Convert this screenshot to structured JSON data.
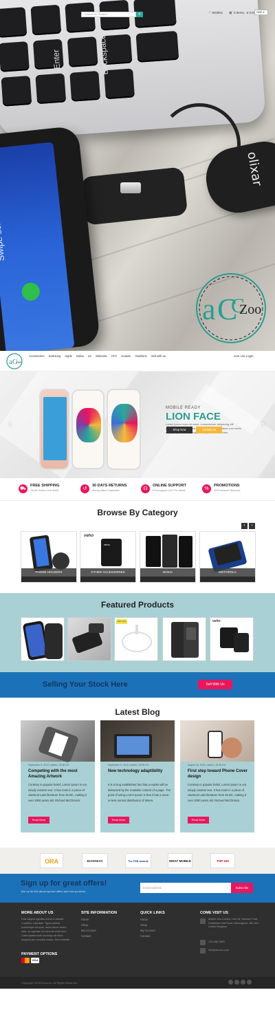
{
  "hero": {
    "phone_text": "Swipe screen to unlock",
    "brand_device": "olixar",
    "key_backspace": "Backspace",
    "key_enter": "Enter"
  },
  "logo": {
    "text": "aCCZoo"
  },
  "header": {
    "nav": [
      "Accessories",
      "Samsung",
      "Apple",
      "Nokia",
      "LG",
      "Motorola",
      "HTC",
      "Huawei",
      "Vodafone",
      "Sell with us"
    ],
    "account": "Join Us/ Login",
    "search_placeholder": "Search for Product",
    "wishlist": "Wishlist",
    "cart": "0 Items - £ 0.00",
    "currency": "GBP £"
  },
  "slider": {
    "subheading": "MOBILE READY",
    "heading": "LION FACE",
    "description": "Lorem ipsum dolor sit amet, consectetuer adipiscing elit. Aenean commodo ligula eget dolor. Aenean massa cum sociis natoque penatibus et magnis dis parturient montes.",
    "btn_shop": "Shop Now",
    "btn_contact": "Contact us",
    "prev": "‹",
    "next": "›"
  },
  "features": [
    {
      "icon": "truck-icon",
      "title": "FREE SHIPPING",
      "sub": "On All Orders Over $120"
    },
    {
      "icon": "return-icon",
      "title": "30 DAYS RETURNS",
      "sub": "Money Back Guarantee"
    },
    {
      "icon": "headset-icon",
      "title": "ONLINE SUPPORT",
      "sub": "Free support 24/7 Per Week"
    },
    {
      "icon": "tag-icon",
      "title": "PROMOTIONS",
      "sub": "10% Member Discount"
    }
  ],
  "categories": {
    "title": "Browse By Category",
    "items": [
      {
        "label": "PHONE HOLDERS",
        "bar": "PHONE HOLDERS"
      },
      {
        "label": "OTHER ACCESSORIES",
        "bar": "OTHER ACCESSORIES"
      },
      {
        "label": "NOKIA",
        "bar": "NOKIA"
      },
      {
        "label": "MOTOROLA",
        "bar": "MOTOROLA"
      }
    ]
  },
  "featured": {
    "title": "Featured Products",
    "sale_badge": "20% OFF"
  },
  "selling": {
    "text": "Selling Your Stock Here",
    "button": "Sell With Us"
  },
  "blog": {
    "title": "Latest Blog",
    "posts": [
      {
        "meta": "September 9, 2015  |  admin  |  36 BLOG",
        "title": "Competing with the most Amazing Artwork",
        "text": "Contrary to popular belief, Lorem Ipsum is not simply random text. It has roots in a piece of classical Latin literature from 45 BC, making it over 2000 years old. Richard McClintock.",
        "button": "Read More"
      },
      {
        "meta": "September 9, 2015  |  admin  |  36 BLOG",
        "title": "New technology adaptibility",
        "text": "It is a long established fact that a reader will be distracted by the readable content of a page. The point of using Lorem Ipsum is that it has a more-or-less normal distribution of letters.",
        "button": "Read More"
      },
      {
        "meta": "August 18, 2015  |  admin  |  36 BLOG",
        "title": "First step toward Phone Cover design",
        "text": "Contrary to popular belief, Lorem Ipsum is not simply random text. It has roots in a piece of classical Latin literature from 45 BC, making it over 2000 years old. Richard McClintock.",
        "button": "Read More"
      }
    ]
  },
  "partners": [
    "ORA",
    "BUSINESS",
    "The FSB Awards",
    "WHAT MOBILE",
    "TOP 100"
  ],
  "signup": {
    "title": "Sign up for great offers!",
    "sub": "Join us be first about special offers and new products",
    "placeholder": "Email Address",
    "button": "Subscribe"
  },
  "footer": {
    "about_title": "MORE ABOUT US",
    "about_text": "Duis aliquet egestas purus in blandit. Curabitur vulputate. Typus lacinia scelerisque tempus, lacus lacus ornare ante, ac egestas est urna sit amet arcu. Class aptent taciti sociosqu ad litora torquent per conubia nostra. Sed molestie.",
    "site_title": "SITE INFORMATION",
    "site_links": [
      "Home",
      "Shop",
      "My Account",
      "Contact"
    ],
    "quick_title": "QUICK LINKS",
    "quick_links": [
      "Home",
      "Shop",
      "My Account",
      "Contact"
    ],
    "visit_title": "COME VISIT US",
    "address": "Mobile Zoo Limited, Unit 18, Network Park, Duddeston Mill Road, Birmingham, B8 1AU, United Kingdom",
    "phone": "123-456-7890",
    "email": "info@acczoo.com",
    "payment_title": "PAYMENT OPTIONS",
    "copyright": "Copyright ©2016 Acczoo. All Rights Reserved"
  },
  "colors": {
    "teal": "#2a9d8f",
    "pink": "#e8175d",
    "blue": "#1c72b8",
    "light_teal": "#a9d1d5",
    "dark": "#2f2f2f"
  }
}
